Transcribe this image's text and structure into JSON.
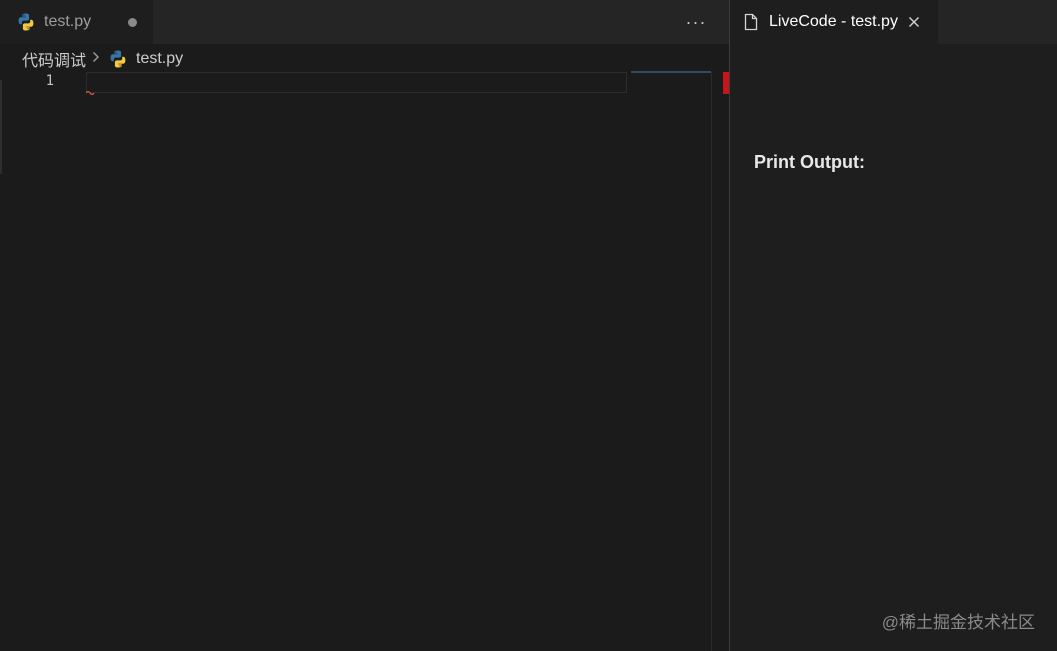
{
  "editor": {
    "tab": {
      "label": "test.py",
      "icon": "python-icon",
      "dirty": true
    },
    "more_actions_label": "···",
    "breadcrumb": {
      "folder": "代码调试",
      "separator": "›",
      "file": "test.py",
      "icon": "python-icon"
    },
    "lines": [
      {
        "number": "1",
        "content": ""
      }
    ],
    "diagnostics": {
      "error_color": "#c7161b"
    }
  },
  "livecode": {
    "tab": {
      "label": "LiveCode - test.py",
      "icon": "file-icon",
      "close_icon": "close-icon"
    },
    "output_heading": "Print Output:"
  },
  "watermark": "@稀土掘金技术社区",
  "colors": {
    "background": "#1e1e1e",
    "tab_strip": "#252526",
    "python_blue": "#3775a9",
    "python_yellow": "#f5c93c"
  }
}
